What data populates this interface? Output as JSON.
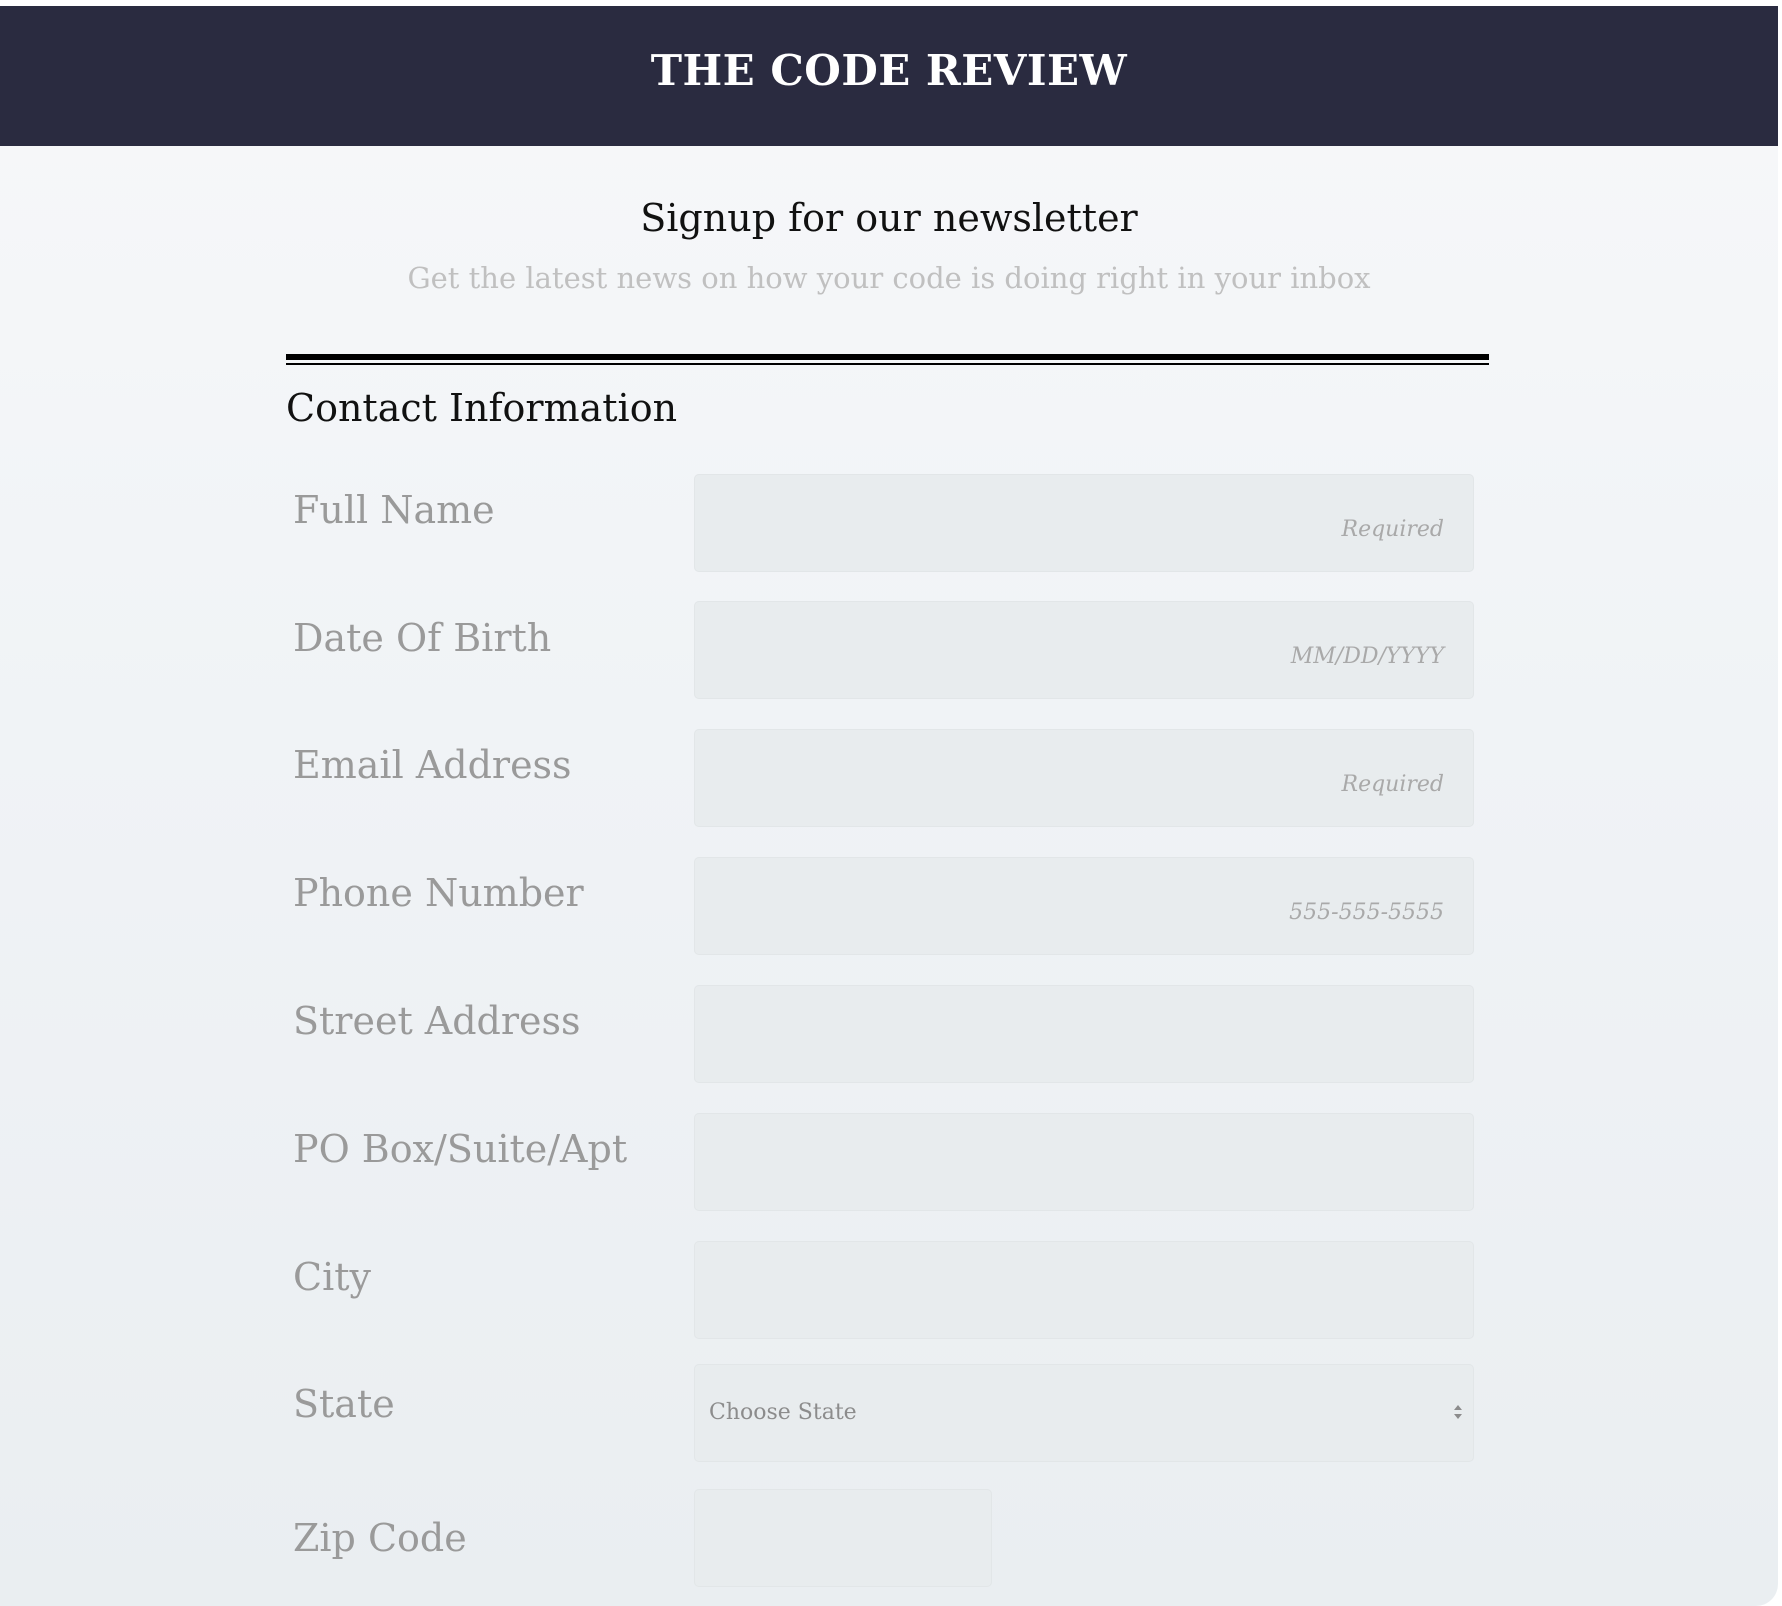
{
  "header": {
    "title": "THE CODE REVIEW"
  },
  "intro": {
    "title": "Signup for our newsletter",
    "subtitle": "Get the latest news on how your code is doing right in your inbox"
  },
  "section": {
    "title": "Contact Information"
  },
  "fields": {
    "full_name": {
      "label": "Full Name",
      "placeholder": "Required"
    },
    "dob": {
      "label": "Date Of Birth",
      "placeholder": "MM/DD/YYYY"
    },
    "email": {
      "label": "Email Address",
      "placeholder": "Required"
    },
    "phone": {
      "label": "Phone Number",
      "placeholder": "555-555-5555"
    },
    "street": {
      "label": "Street Address",
      "placeholder": ""
    },
    "po_box": {
      "label": "PO Box/Suite/Apt",
      "placeholder": ""
    },
    "city": {
      "label": "City",
      "placeholder": ""
    },
    "state": {
      "label": "State",
      "selected": "Choose State"
    },
    "zip": {
      "label": "Zip Code",
      "placeholder": ""
    }
  },
  "colors": {
    "header_bg": "#2a2b40",
    "input_bg": "#e8ecee",
    "label_text": "#9a9a9a"
  }
}
